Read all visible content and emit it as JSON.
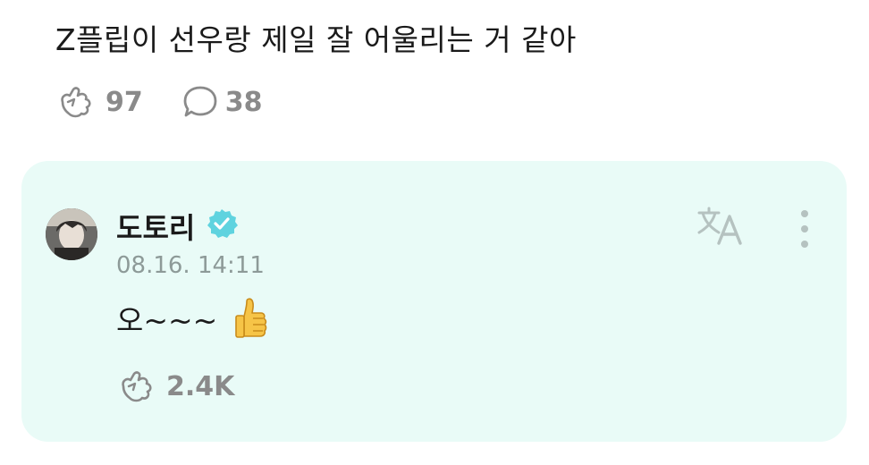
{
  "post": {
    "text": "Z플립이 선우랑 제일 잘 어울리는 거 같아",
    "likes": "97",
    "comments": "38"
  },
  "reply": {
    "author": "도토리",
    "verified": true,
    "timestamp": "08.16. 14:11",
    "text": "오~~~",
    "emoji": "thumbs-up",
    "likes": "2.4K"
  },
  "icons": {
    "like": "hand-wave-like-icon",
    "comment": "comment-bubble-icon",
    "verified": "verified-badge-icon",
    "translate": "translate-icon",
    "more": "more-vertical-icon"
  },
  "colors": {
    "card_bg": "#e9fbf7",
    "verified": "#5fd3df",
    "icon_gray": "#8a8a8a",
    "translate_gray": "#b5c2c0",
    "meta_text": "#8d9a98"
  }
}
